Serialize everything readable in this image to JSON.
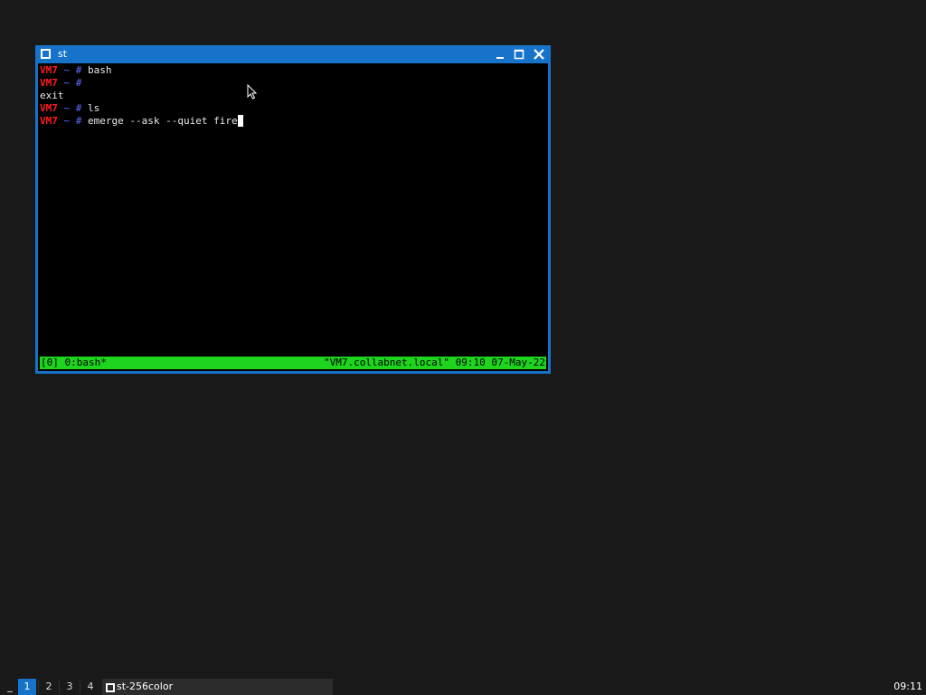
{
  "window": {
    "title": "st",
    "icon": "window-icon",
    "buttons": [
      "minimize-icon",
      "maximize-icon",
      "close-icon"
    ]
  },
  "terminal": {
    "lines": [
      {
        "host": "VM7",
        "tilde": "~",
        "hash": "#",
        "command": " bash"
      },
      {
        "host": "VM7",
        "tilde": "~",
        "hash": "#",
        "command": ""
      },
      {
        "text": "exit"
      },
      {
        "host": "VM7",
        "tilde": "~",
        "hash": "#",
        "command": " ls"
      },
      {
        "host": "VM7",
        "tilde": "~",
        "hash": "#",
        "command": " emerge --ask --quiet fire"
      }
    ],
    "status_bar": {
      "left": "[0] 0:bash*",
      "right": "\"VM7.collabnet.local\" 09:10 07-May-22"
    }
  },
  "taskbar": {
    "menu_label": "_",
    "workspaces": [
      {
        "label": "1",
        "active": true
      },
      {
        "label": "2",
        "active": false
      },
      {
        "label": "3",
        "active": false
      },
      {
        "label": "4",
        "active": false
      }
    ],
    "task": {
      "label": "st-256color",
      "icon": "window-icon"
    },
    "clock": "09:11"
  },
  "colors": {
    "desktop": "#191919",
    "accent": "#1773c9",
    "terminal_bg": "#000000",
    "prompt_host": "#ff1a1a",
    "prompt_symbols": "#5b6cff",
    "tmux_status": "#1ed41e"
  }
}
